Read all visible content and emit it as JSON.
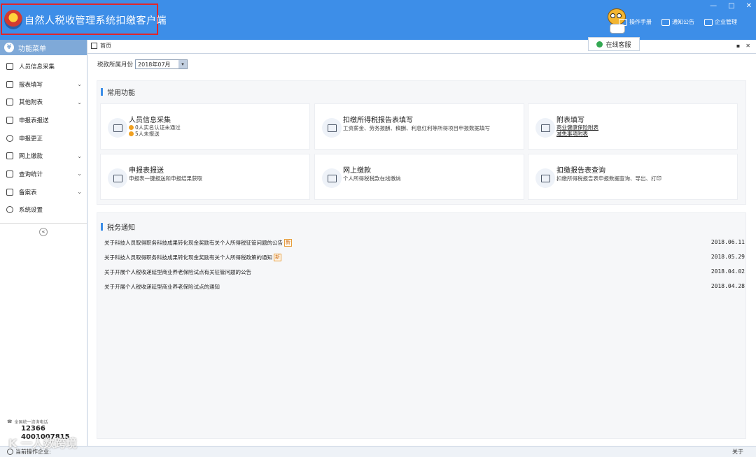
{
  "window": {
    "title": "自然人税收管理系统扣缴客户端",
    "controls": [
      "—",
      "□",
      "✕"
    ]
  },
  "header_links": [
    {
      "label": "操作手册",
      "icon": "book-icon"
    },
    {
      "label": "通知公告",
      "icon": "mail-icon"
    },
    {
      "label": "企业管理",
      "icon": "building-icon"
    }
  ],
  "online_service": "在线客服",
  "sidebar": {
    "title": "功能菜单",
    "items": [
      {
        "label": "人员信息采集",
        "icon": "person-icon",
        "expandable": false
      },
      {
        "label": "报表填写",
        "icon": "edit-icon",
        "expandable": true
      },
      {
        "label": "其他附表",
        "icon": "grid-icon",
        "expandable": true
      },
      {
        "label": "申报表报送",
        "icon": "report-send-icon",
        "expandable": false
      },
      {
        "label": "申报更正",
        "icon": "search-correct-icon",
        "expandable": false
      },
      {
        "label": "网上缴款",
        "icon": "payment-icon",
        "expandable": true
      },
      {
        "label": "查询统计",
        "icon": "stats-icon",
        "expandable": true
      },
      {
        "label": "备案表",
        "icon": "file-icon",
        "expandable": true
      },
      {
        "label": "系统设置",
        "icon": "gear-icon",
        "expandable": false
      }
    ],
    "collapse": "«",
    "hotline_label": "全国统一咨询电话",
    "hotline_1": "12366",
    "hotline_2": "4001007815"
  },
  "tab": {
    "label": "首页"
  },
  "tab_controls": [
    "▪",
    "✕"
  ],
  "period": {
    "label": "税款所属月份",
    "value": "2018年07月",
    "dropdown": "▾"
  },
  "common": {
    "title": "常用功能",
    "cards": [
      {
        "title": "人员信息采集",
        "lines": [
          "0人实名认证未通过",
          "5人未报送"
        ],
        "icon": "person-card-icon",
        "type": "badges"
      },
      {
        "title": "扣缴所得税报告表填写",
        "lines": [
          "工资薪金、劳务报酬、稿酬、利息红利等所得项目申报数据填写"
        ],
        "icon": "form-icon",
        "type": "text"
      },
      {
        "title": "附表填写",
        "lines": [
          "商业健康保险附表",
          "减免事项附表"
        ],
        "icon": "pen-icon",
        "type": "links"
      },
      {
        "title": "申报表报送",
        "lines": [
          "申报表一键报送和申报结果获取"
        ],
        "icon": "send-icon",
        "type": "text"
      },
      {
        "title": "网上缴款",
        "lines": [
          "个人所得税税款在线缴纳"
        ],
        "icon": "wallet-icon",
        "type": "text"
      },
      {
        "title": "扣缴报告表查询",
        "lines": [
          "扣缴所得税报告表申报数据查询、导出、打印"
        ],
        "icon": "query-icon",
        "type": "text"
      }
    ]
  },
  "notices": {
    "title": "税务通知",
    "new_label": "新",
    "items": [
      {
        "text": "关于科技人员取得职务科技成果转化现金奖励有关个人所得税征管问题的公告",
        "date": "2018.06.11",
        "new": true
      },
      {
        "text": "关于科技人员取得职务科技成果转化现金奖励有关个人所得税政策的通知",
        "date": "2018.05.29",
        "new": true
      },
      {
        "text": "关于开展个人税收递延型商业养老保险试点有关征管问题的公告",
        "date": "2018.04.02",
        "new": false
      },
      {
        "text": "关于开展个人税收递延型商业养老保险试点的通知",
        "date": "2018.04.28",
        "new": false
      }
    ]
  },
  "status": {
    "left": "当前操作企业:",
    "right": "关于"
  },
  "watermark": "K 一人数跨境"
}
